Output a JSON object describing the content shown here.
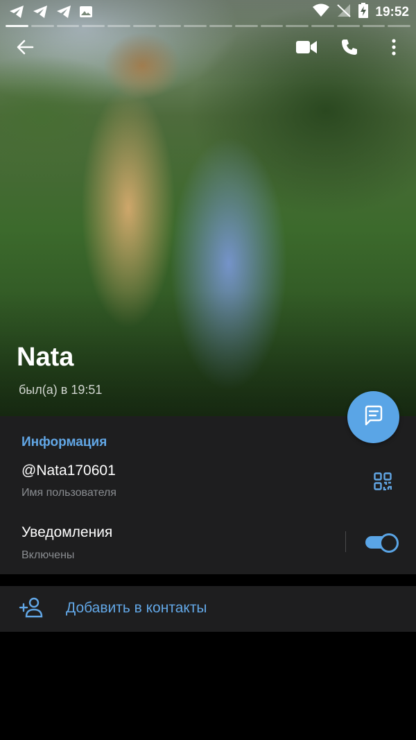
{
  "status_bar": {
    "time": "19:52",
    "left_icons": [
      "telegram-icon",
      "telegram-icon",
      "telegram-icon",
      "image-icon"
    ],
    "right_icons": [
      "wifi-icon",
      "no-sim-icon",
      "battery-charging-icon"
    ]
  },
  "story": {
    "segments": 16,
    "active_segment": 1
  },
  "header": {
    "back_icon": "arrow-left-icon",
    "video_call_icon": "video-camera-icon",
    "call_icon": "phone-icon",
    "menu_icon": "more-vertical-icon"
  },
  "profile": {
    "name": "Nata",
    "last_seen": "был(а) в 19:51"
  },
  "fab_icon": "message-icon",
  "info": {
    "section_title": "Информация",
    "username": "@Nata170601",
    "username_caption": "Имя пользователя",
    "qr_icon": "qr-code-icon",
    "notifications_label": "Уведомления",
    "notifications_value": "Включены",
    "notifications_enabled": true
  },
  "actions": {
    "add_contact_label": "Добавить в контакты",
    "add_contact_icon": "add-person-icon"
  },
  "colors": {
    "accent": "#5aa5e6",
    "card_background": "#1e1e1f",
    "background": "#000000"
  }
}
